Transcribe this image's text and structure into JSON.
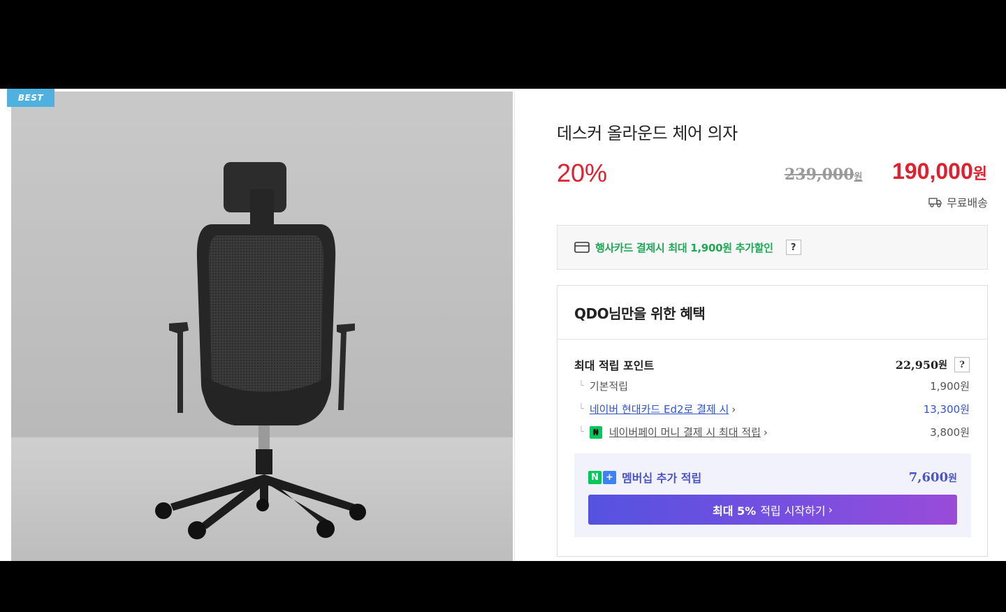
{
  "badge": "BEST",
  "product": {
    "title": "데스커 올라운드 체어 의자",
    "discount": "20%",
    "original_price": "239,000",
    "original_currency": "원",
    "sale_price": "190,000",
    "sale_currency": "원",
    "shipping": "무료배송"
  },
  "card_promo": {
    "text": "행사카드 결제시 최대 1,900원 추가할인",
    "help": "?"
  },
  "benefits": {
    "title": "QDO님만을 위한 혜택",
    "max_points_label": "최대 적립 포인트",
    "max_points_value": "22,950",
    "max_points_currency": "원",
    "help": "?",
    "items": [
      {
        "label": "기본적립",
        "value": "1,900원"
      },
      {
        "label": "네이버 현대카드 Ed2로 결제 시",
        "value": "13,300원"
      },
      {
        "label": "네이버페이 머니 결제 시 최대 적립",
        "value": "3,800원"
      }
    ],
    "membership": {
      "label": "멤버십 추가 적립",
      "value": "7,600",
      "currency": "원",
      "cta_bold": "최대 5%",
      "cta_rest": "적립 시작하기"
    }
  },
  "colors": {
    "sale_red": "#e0202e",
    "card_green": "#1fa956",
    "link_blue": "#3355cc",
    "member_purple": "#4a54c8",
    "badge_blue": "#4fb1de"
  }
}
